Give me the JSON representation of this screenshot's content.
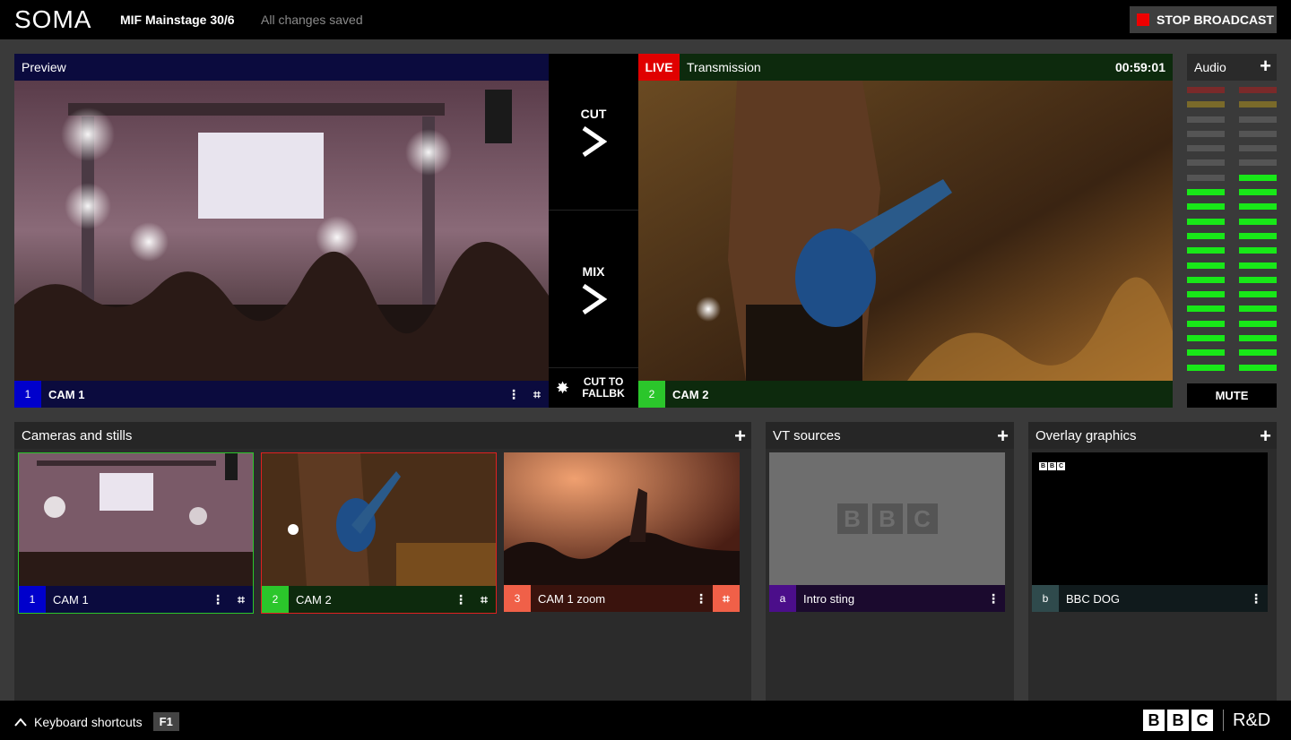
{
  "topbar": {
    "logo": "SOMA",
    "event_name": "MIF Mainstage 30/6",
    "save_status": "All changes saved",
    "stop_label": "STOP BROADCAST"
  },
  "preview": {
    "title": "Preview",
    "number": "1",
    "source": "CAM 1"
  },
  "transition": {
    "cut": "CUT",
    "mix": "MIX",
    "fallback": "CUT TO FALLBK"
  },
  "transmission": {
    "live": "LIVE",
    "title": "Transmission",
    "timer": "00:59:01",
    "number": "2",
    "source": "CAM 2"
  },
  "audio": {
    "title": "Audio",
    "mute": "MUTE",
    "left_level": 0.65,
    "right_level": 0.72
  },
  "cameras": {
    "title": "Cameras and stills",
    "items": [
      {
        "number": "1",
        "label": "CAM 1"
      },
      {
        "number": "2",
        "label": "CAM 2"
      },
      {
        "number": "3",
        "label": "CAM 1 zoom"
      }
    ]
  },
  "vt": {
    "title": "VT sources",
    "items": [
      {
        "number": "a",
        "label": "Intro sting",
        "logo": "BBC"
      }
    ]
  },
  "overlay": {
    "title": "Overlay graphics",
    "items": [
      {
        "number": "b",
        "label": "BBC DOG",
        "logo": "BBC"
      }
    ]
  },
  "footer": {
    "shortcuts": "Keyboard shortcuts",
    "key": "F1",
    "brand": "BBC",
    "division": "R&D"
  },
  "colors": {
    "preview_blue": "#0b0b3e",
    "preview_num": "#0000cc",
    "live_red": "#e00000",
    "program_green": "#0d2a0d",
    "program_num": "#2bc62b",
    "zoom_red": "#3a130d",
    "zoom_num": "#f06048",
    "vt_purple": "#1b0a2e",
    "vt_num": "#4b0e8a",
    "overlay_dark": "#101a1c",
    "overlay_num": "#2f4a4c",
    "meter_on": "#18e818"
  }
}
